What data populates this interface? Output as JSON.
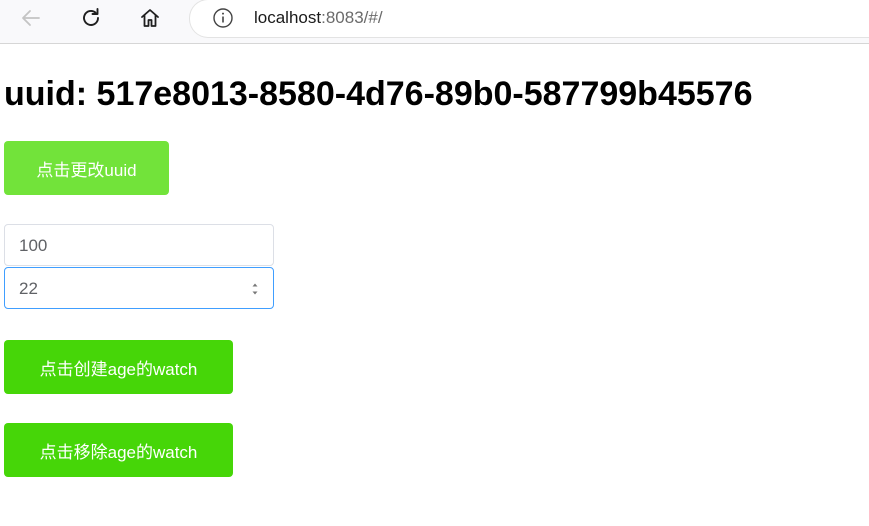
{
  "browser": {
    "url_host": "localhost",
    "url_rest": ":8083/#/"
  },
  "page": {
    "uuid_label": "uuid: ",
    "uuid_value": "517e8013-8580-4d76-89b0-587799b45576",
    "change_uuid_button": "点击更改uuid",
    "text_input_value": "100",
    "age_input_value": "22",
    "create_watch_button": "点击创建age的watch",
    "remove_watch_button": "点击移除age的watch"
  },
  "colors": {
    "light_green": "#72e33a",
    "green": "#46d608",
    "focus_blue": "#409eff"
  },
  "icons": [
    "back-arrow-icon",
    "reload-icon",
    "home-icon",
    "info-icon",
    "spinner-arrows-icon"
  ]
}
